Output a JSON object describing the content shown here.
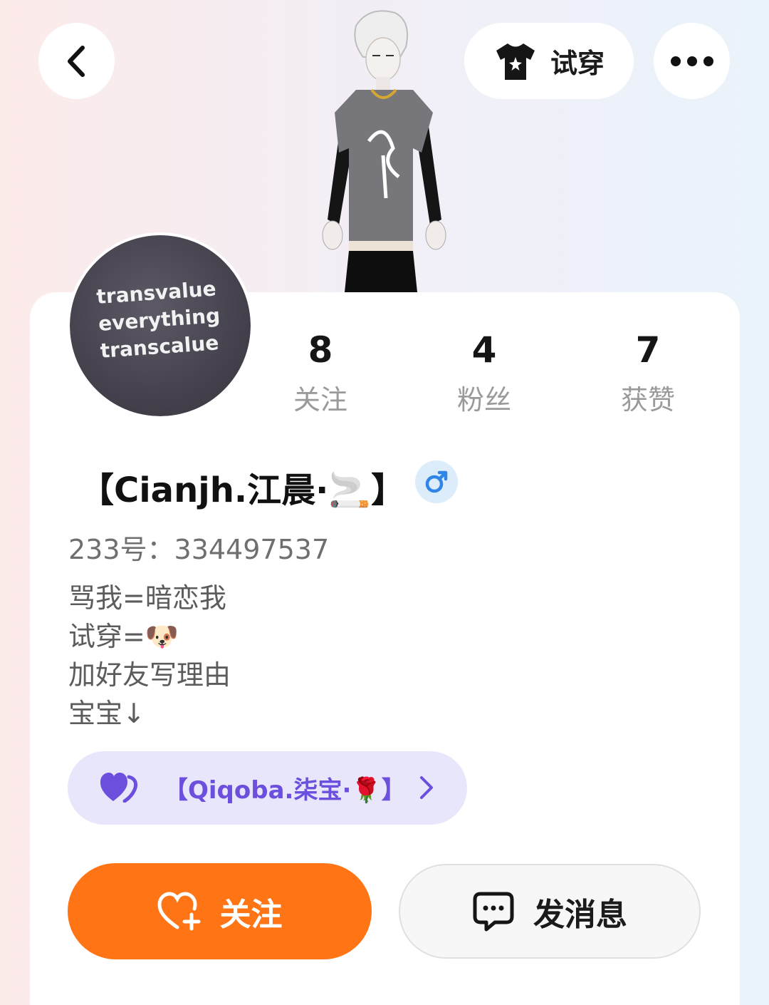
{
  "header": {
    "back_icon": "chevron-left-icon",
    "tryon_label": "试穿",
    "tryon_icon": "tshirt-icon",
    "more_icon": "more-dots-icon"
  },
  "profile": {
    "avatar_text_lines": [
      "transvalue",
      "everything",
      "transcalue"
    ],
    "username": "【Cianjh.江晨·🚬】",
    "gender_symbol": "♂",
    "account_id": "233号：334497537",
    "bio": [
      "骂我=暗恋我",
      "试穿=🐶",
      "加好友写理由",
      "宝宝↓"
    ]
  },
  "stats": [
    {
      "value": "8",
      "label": "关注"
    },
    {
      "value": "4",
      "label": "粉丝"
    },
    {
      "value": "7",
      "label": "获赞"
    }
  ],
  "relationship": {
    "name": "【Qiqoba.柒宝·🌹】",
    "icon": "double-heart-icon"
  },
  "actions": {
    "follow_label": "关注",
    "message_label": "发消息"
  },
  "colors": {
    "accent_orange": "#ff7415",
    "purple": "#6c4fdc",
    "pill_bg": "#e8e6fb",
    "gender_blue": "#2f86e6"
  }
}
